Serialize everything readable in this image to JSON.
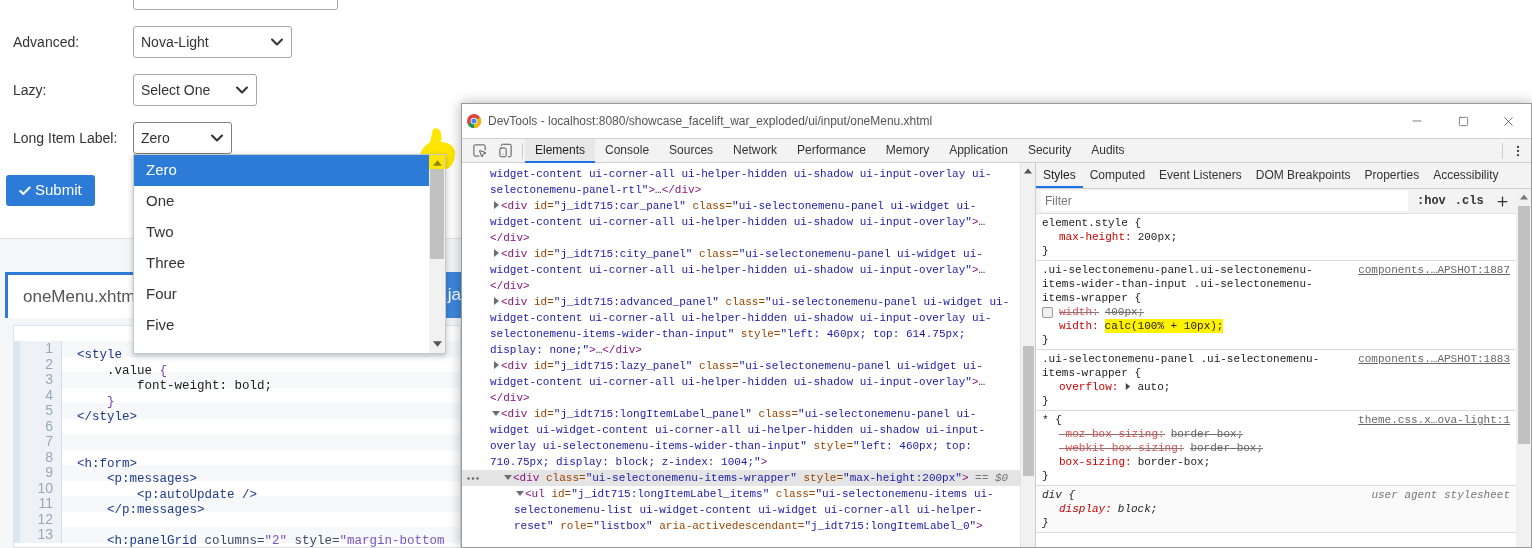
{
  "page": {
    "form": {
      "fields": [
        {
          "kind": "text"
        },
        {
          "kind": "select",
          "label": "Advanced:",
          "value": "Nova-Light",
          "expanded": false
        },
        {
          "kind": "select",
          "label": "Lazy:",
          "value": "Select One",
          "expanded": false
        },
        {
          "kind": "select",
          "label": "Long Item Label:",
          "value": "Zero",
          "expanded": true,
          "options": [
            {
              "label": "Zero",
              "selected": true
            },
            {
              "label": "One",
              "selected": false
            },
            {
              "label": "Two",
              "selected": false
            },
            {
              "label": "Three",
              "selected": false
            },
            {
              "label": "Four",
              "selected": false
            },
            {
              "label": "Five",
              "selected": false
            }
          ]
        }
      ],
      "submit": {
        "label": "Submit"
      }
    },
    "tabs": [
      {
        "label": "oneMenu.xhtm",
        "selected": true
      },
      {
        "label": ".ja",
        "selected": false
      }
    ],
    "code_lines": [
      {
        "number": "1",
        "tokens": [
          {
            "kind": "tag",
            "text": "<style"
          }
        ]
      },
      {
        "number": "2",
        "tokens": [
          {
            "kind": "plain",
            "text": "    .value "
          },
          {
            "kind": "punct",
            "text": "{"
          }
        ]
      },
      {
        "number": "3",
        "tokens": [
          {
            "kind": "plain",
            "text": "        font-weight: bold;"
          }
        ]
      },
      {
        "number": "4",
        "tokens": [
          {
            "kind": "punct",
            "text": "    }"
          }
        ]
      },
      {
        "number": "5",
        "tokens": [
          {
            "kind": "tag",
            "text": "</style>"
          }
        ]
      },
      {
        "number": "6"
      },
      {
        "number": "7"
      },
      {
        "number": "8",
        "tokens": [
          {
            "kind": "tag",
            "text": "<h:form>"
          }
        ]
      },
      {
        "number": "9",
        "tokens": [
          {
            "kind": "tag",
            "text": "    <p:messages>"
          }
        ]
      },
      {
        "number": "10",
        "tokens": [
          {
            "kind": "tag",
            "text": "        <p:autoUpdate />"
          }
        ]
      },
      {
        "number": "11",
        "tokens": [
          {
            "kind": "tag",
            "text": "    </p:messages>"
          }
        ]
      },
      {
        "number": "12"
      },
      {
        "number": "13",
        "tokens": [
          {
            "kind": "tag",
            "text": "    <h:panelGrid"
          },
          {
            "kind": "attr",
            "text": " columns="
          },
          {
            "kind": "value",
            "text": "\"2\""
          },
          {
            "kind": "attr",
            "text": " style="
          },
          {
            "kind": "value",
            "text": "\"margin-bottom"
          }
        ]
      }
    ]
  },
  "devtools": {
    "title": "DevTools - localhost:8080/showcase_facelift_war_exploded/ui/input/oneMenu.xhtml",
    "tabs": [
      {
        "label": "Elements",
        "selected": true
      },
      {
        "label": "Console",
        "selected": false
      },
      {
        "label": "Sources",
        "selected": false
      },
      {
        "label": "Network",
        "selected": false
      },
      {
        "label": "Performance",
        "selected": false
      },
      {
        "label": "Memory",
        "selected": false
      },
      {
        "label": "Application",
        "selected": false
      },
      {
        "label": "Security",
        "selected": false
      },
      {
        "label": "Audits",
        "selected": false
      }
    ],
    "elements": {
      "nodes": [
        {
          "selected": false,
          "tokens": [
            {
              "kind": "value",
              "text": "widget-content ui-corner-all ui-helper-hidden ui-shadow ui-input-overlay ui-selectonemenu-panel-rtl\""
            },
            {
              "kind": "tag",
              "text": ">"
            },
            {
              "kind": "text",
              "text": "…"
            },
            {
              "kind": "tag",
              "text": "</div>"
            }
          ]
        },
        {
          "selected": false,
          "expanded": false,
          "tokens": [
            {
              "kind": "tag",
              "text": "<div"
            },
            {
              "kind": "attr",
              "text": " id="
            },
            {
              "kind": "value",
              "text": "\"j_idt715:car_panel\""
            },
            {
              "kind": "attr",
              "text": " class="
            },
            {
              "kind": "value",
              "text": "\"ui-selectonemenu-panel ui-widget ui-widget-content ui-corner-all ui-helper-hidden ui-shadow ui-input-overlay\""
            },
            {
              "kind": "tag",
              "text": ">"
            },
            {
              "kind": "text",
              "text": "…"
            },
            {
              "kind": "tag",
              "text": "</div>"
            }
          ]
        },
        {
          "selected": false,
          "expanded": false,
          "tokens": [
            {
              "kind": "tag",
              "text": "<div"
            },
            {
              "kind": "attr",
              "text": " id="
            },
            {
              "kind": "value",
              "text": "\"j_idt715:city_panel\""
            },
            {
              "kind": "attr",
              "text": " class="
            },
            {
              "kind": "value",
              "text": "\"ui-selectonemenu-panel ui-widget ui-widget-content ui-corner-all ui-helper-hidden ui-shadow ui-input-overlay\""
            },
            {
              "kind": "tag",
              "text": ">"
            },
            {
              "kind": "text",
              "text": "…"
            },
            {
              "kind": "tag",
              "text": "</div>"
            }
          ]
        },
        {
          "selected": false,
          "expanded": false,
          "tokens": [
            {
              "kind": "tag",
              "text": "<div"
            },
            {
              "kind": "attr",
              "text": " id="
            },
            {
              "kind": "value",
              "text": "\"j_idt715:advanced_panel\""
            },
            {
              "kind": "attr",
              "text": " class="
            },
            {
              "kind": "value",
              "text": "\"ui-selectonemenu-panel ui-widget ui-widget-content ui-corner-all ui-helper-hidden ui-shadow ui-input-overlay ui-selectonemenu-items-wider-than-input\""
            },
            {
              "kind": "attr",
              "text": " style="
            },
            {
              "kind": "value",
              "text": "\"left: 460px; top: 614.75px; display: none;\""
            },
            {
              "kind": "tag",
              "text": ">"
            },
            {
              "kind": "text",
              "text": "…"
            },
            {
              "kind": "tag",
              "text": "</div>"
            }
          ]
        },
        {
          "selected": false,
          "expanded": false,
          "tokens": [
            {
              "kind": "tag",
              "text": "<div"
            },
            {
              "kind": "attr",
              "text": " id="
            },
            {
              "kind": "value",
              "text": "\"j_idt715:lazy_panel\""
            },
            {
              "kind": "attr",
              "text": " class="
            },
            {
              "kind": "value",
              "text": "\"ui-selectonemenu-panel ui-widget ui-widget-content ui-corner-all ui-helper-hidden ui-shadow ui-input-overlay\""
            },
            {
              "kind": "tag",
              "text": ">"
            },
            {
              "kind": "text",
              "text": "…"
            },
            {
              "kind": "tag",
              "text": "</div>"
            }
          ]
        },
        {
          "selected": false,
          "expanded": true,
          "tokens": [
            {
              "kind": "tag",
              "text": "<div"
            },
            {
              "kind": "attr",
              "text": " id="
            },
            {
              "kind": "value",
              "text": "\"j_idt715:longItemLabel_panel\""
            },
            {
              "kind": "attr",
              "text": " class="
            },
            {
              "kind": "value",
              "text": "\"ui-selectonemenu-panel ui-widget ui-widget-content ui-corner-all ui-helper-hidden ui-shadow ui-input-overlay ui-selectonemenu-items-wider-than-input\""
            },
            {
              "kind": "attr",
              "text": " style="
            },
            {
              "kind": "value",
              "text": "\"left: 460px; top: 710.75px; display: block; z-index: 1004;\""
            },
            {
              "kind": "tag",
              "text": ">"
            }
          ],
          "children": [
            {
              "selected": true,
              "expanded": true,
              "tokens": [
                {
                  "kind": "tag",
                  "text": "<div"
                },
                {
                  "kind": "attr",
                  "text": " class="
                },
                {
                  "kind": "value",
                  "text": "\"ui-selectonemenu-items-wrapper\""
                },
                {
                  "kind": "attr",
                  "text": " style="
                },
                {
                  "kind": "value",
                  "text": "\"max-height:200px\""
                },
                {
                  "kind": "tag",
                  "text": ">"
                },
                {
                  "kind": "marker",
                  "text": " == $0"
                }
              ],
              "children": [
                {
                  "selected": false,
                  "expanded": true,
                  "tokens": [
                    {
                      "kind": "tag",
                      "text": "<ul"
                    },
                    {
                      "kind": "attr",
                      "text": " id="
                    },
                    {
                      "kind": "value",
                      "text": "\"j_idt715:longItemLabel_items\""
                    },
                    {
                      "kind": "attr",
                      "text": " class="
                    },
                    {
                      "kind": "value",
                      "text": "\"ui-selectonemenu-items ui-selectonemenu-list ui-widget-content ui-widget ui-corner-all ui-helper-reset\""
                    },
                    {
                      "kind": "attr",
                      "text": " role="
                    },
                    {
                      "kind": "value",
                      "text": "\"listbox\""
                    },
                    {
                      "kind": "attr",
                      "text": " aria-activedescendant="
                    },
                    {
                      "kind": "value",
                      "text": "\"j_idt715:longItemLabel_0\""
                    },
                    {
                      "kind": "tag",
                      "text": ">"
                    }
                  ]
                }
              ]
            }
          ]
        }
      ]
    },
    "sidebar_tabs": [
      {
        "label": "Styles",
        "selected": true
      },
      {
        "label": "Computed",
        "selected": false
      },
      {
        "label": "Event Listeners",
        "selected": false
      },
      {
        "label": "DOM Breakpoints",
        "selected": false
      },
      {
        "label": "Properties",
        "selected": false
      },
      {
        "label": "Accessibility",
        "selected": false
      }
    ],
    "styles": {
      "filter": {
        "placeholder": "Filter"
      },
      "toggles": [
        ":hov",
        ".cls"
      ],
      "rules": [
        {
          "kind": "inline",
          "selector": "element.style {",
          "close": "}",
          "declarations": [
            {
              "name": "max-height:",
              "value": "200px;",
              "struck": false,
              "highlighted": false
            }
          ]
        },
        {
          "kind": "author",
          "selector": ".ui-selectonemenu-panel.ui-selectonemenu-items-wider-than-input .ui-selectonemenu-items-wrapper {",
          "source": "components.…APSHOT:1887",
          "close": "}",
          "declarations": [
            {
              "name": "width:",
              "value": "400px;",
              "struck": true,
              "highlighted": false,
              "checked": false
            },
            {
              "name": "width:",
              "value": "calc(100% + 10px);",
              "struck": false,
              "highlighted": true
            }
          ]
        },
        {
          "kind": "author",
          "selector": ".ui-selectonemenu-panel .ui-selectonemenu-items-wrapper {",
          "source": "components.…APSHOT:1883",
          "close": "}",
          "declarations": [
            {
              "name": "overflow:",
              "value": "auto;",
              "struck": false,
              "highlighted": false,
              "expandable": true
            }
          ]
        },
        {
          "kind": "author",
          "selector": "* {",
          "source": "theme.css.x…ova-light:1",
          "close": "}",
          "declarations": [
            {
              "name": "-moz-box-sizing:",
              "value": "border-box;",
              "struck": true,
              "highlighted": false
            },
            {
              "name": "-webkit-box-sizing:",
              "value": "border-box;",
              "struck": true,
              "highlighted": false
            },
            {
              "name": "box-sizing:",
              "value": "border-box;",
              "struck": false,
              "highlighted": false
            }
          ]
        },
        {
          "kind": "user-agent",
          "selector": "div {",
          "source": "user agent stylesheet",
          "close": "}",
          "declarations": [
            {
              "name": "display:",
              "value": "block;",
              "struck": false,
              "highlighted": false
            }
          ]
        }
      ]
    }
  }
}
